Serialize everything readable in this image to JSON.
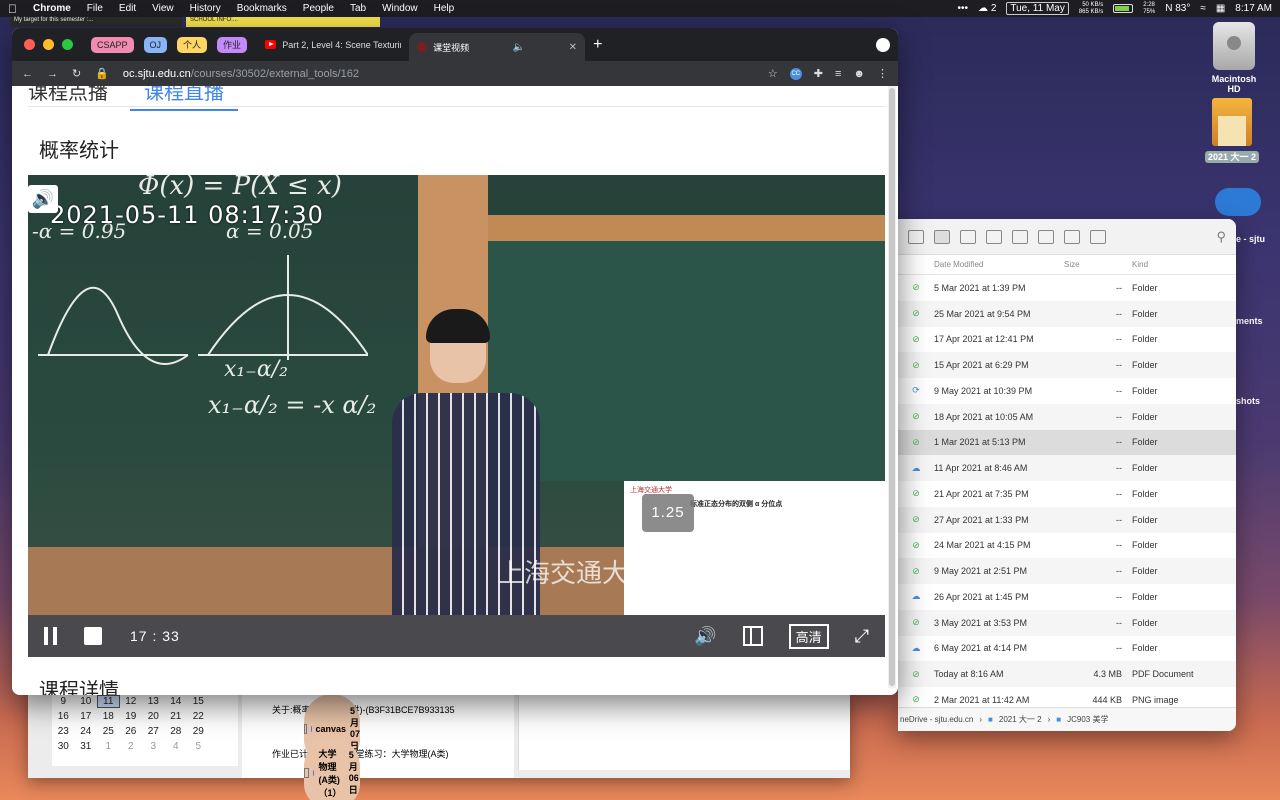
{
  "menubar": {
    "apple": "",
    "app_name": "Chrome",
    "menus": [
      "File",
      "Edit",
      "View",
      "History",
      "Bookmarks",
      "People",
      "Tab",
      "Window",
      "Help"
    ],
    "status": {
      "dots": "•••",
      "wechat_count": "2",
      "date": "Tue, 11 May",
      "net_up": "50 KB/s",
      "net_down": "865 KB/s",
      "bat_time": "2:28",
      "bat_pct": "75%",
      "temp": "N 83°",
      "time": "8:17 AM"
    }
  },
  "notes": {
    "note1": "My target for this semester :...",
    "note2": "SCHOOL INFO:..."
  },
  "desktop": {
    "hd_label": "Macintosh HD",
    "school_label": "2021 大一 2",
    "cloud_label": "e - sjtu",
    "frag_ments": "ments",
    "frag_shots": "shots"
  },
  "chrome": {
    "groups": [
      "CSAPP",
      "OJ",
      "个人",
      "作业"
    ],
    "tab1_title": "Part 2, Level 4: Scene Texturing",
    "tab2_title": "课堂视频",
    "url_host": "oc.sjtu.edu.cn",
    "url_path": "/courses/30502/external_tools/162",
    "ext_label": "CC"
  },
  "page": {
    "tab_record": "课程点播",
    "tab_live": "课程直播",
    "section_title": "概率统计",
    "section_details": "课程详情"
  },
  "video": {
    "timestamp": "2021-05-11  08:17:30",
    "chalk_top": "Φ(x) = P(X ≤ x)",
    "chalk_alpha1": "-α = 0.95",
    "chalk_alpha2": "α = 0.05",
    "chalk_x1": "x₁₋α/₂",
    "chalk_x2": "x₁₋α/₂ = -x α/₂",
    "watermark": "上海交通大",
    "slide_logo": "上海交通大学",
    "slide_title": "标准正态分布的双侧 α 分位点",
    "speed": "1.25",
    "elapsed": "17 : 33",
    "quality": "高清"
  },
  "finder": {
    "columns": {
      "date": "Date Modified",
      "size": "Size",
      "kind": "Kind"
    },
    "rows": [
      {
        "status": "ok",
        "date": "5 Mar 2021 at 1:39 PM",
        "size": "--",
        "kind": "Folder"
      },
      {
        "status": "ok",
        "date": "25 Mar 2021 at 9:54 PM",
        "size": "--",
        "kind": "Folder"
      },
      {
        "status": "ok",
        "date": "17 Apr 2021 at 12:41 PM",
        "size": "--",
        "kind": "Folder"
      },
      {
        "status": "ok",
        "date": "15 Apr 2021 at 6:29 PM",
        "size": "--",
        "kind": "Folder"
      },
      {
        "status": "sync",
        "date": "9 May 2021 at 10:39 PM",
        "size": "--",
        "kind": "Folder"
      },
      {
        "status": "ok",
        "date": "18 Apr 2021 at 10:05 AM",
        "size": "--",
        "kind": "Folder"
      },
      {
        "status": "ok",
        "date": "1 Mar 2021 at 5:13 PM",
        "size": "--",
        "kind": "Folder"
      },
      {
        "status": "cloud",
        "date": "11 Apr 2021 at 8:46 AM",
        "size": "--",
        "kind": "Folder"
      },
      {
        "status": "ok",
        "date": "21 Apr 2021 at 7:35 PM",
        "size": "--",
        "kind": "Folder"
      },
      {
        "status": "ok",
        "date": "27 Apr 2021 at 1:33 PM",
        "size": "--",
        "kind": "Folder"
      },
      {
        "status": "ok",
        "date": "24 Mar 2021 at 4:15 PM",
        "size": "--",
        "kind": "Folder"
      },
      {
        "status": "ok",
        "date": "9 May 2021 at 2:51 PM",
        "size": "--",
        "kind": "Folder"
      },
      {
        "status": "cloud",
        "date": "26 Apr 2021 at 1:45 PM",
        "size": "--",
        "kind": "Folder"
      },
      {
        "status": "ok",
        "date": "3 May 2021 at 3:53 PM",
        "size": "--",
        "kind": "Folder"
      },
      {
        "status": "cloud",
        "date": "6 May 2021 at 4:14 PM",
        "size": "--",
        "kind": "Folder"
      },
      {
        "status": "ok",
        "date": "Today at 8:16 AM",
        "size": "4.3 MB",
        "kind": "PDF Document"
      },
      {
        "status": "ok",
        "date": "2 Mar 2021 at 11:42 AM",
        "size": "444 KB",
        "kind": "PNG image"
      }
    ],
    "path": {
      "seg1": "neDrive - sjtu.edu.cn",
      "seg2": "2021 大一 2",
      "seg3": "JC903 美学"
    }
  },
  "mail": {
    "calendar": [
      [
        "9",
        "10",
        "11",
        "12",
        "13",
        "14",
        "15"
      ],
      [
        "16",
        "17",
        "18",
        "19",
        "20",
        "21",
        "22"
      ],
      [
        "23",
        "24",
        "25",
        "26",
        "27",
        "28",
        "29"
      ],
      [
        "30",
        "31",
        "1",
        "2",
        "3",
        "4",
        "5"
      ]
    ],
    "items": [
      {
        "from": "canvas",
        "date": "5 月07日",
        "subject": "关于:概率统计(第33讲)-(B3F31BCE7B933135"
      },
      {
        "from": "大学物理(A类) （1）",
        "date": "5 月06日",
        "subject": "作业已计分 第三次课堂练习：大学物理(A类)"
      }
    ]
  }
}
